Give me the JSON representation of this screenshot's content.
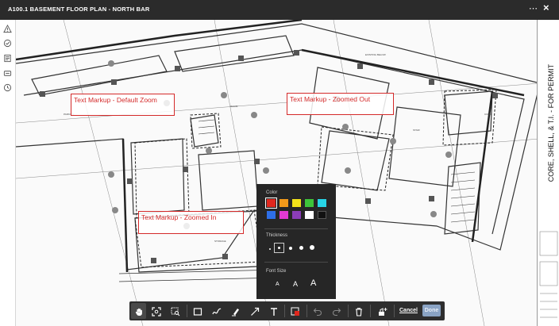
{
  "window": {
    "title": "A100.1 BASEMENT FLOOR PLAN - NORTH BAR",
    "more_icon": "more-icon",
    "close_icon": "close-icon"
  },
  "left_toolbar": [
    "warning-icon",
    "check-circle-icon",
    "sheet-icon",
    "tag-icon",
    "clock-icon"
  ],
  "markups": [
    {
      "text": "Text Markup - Default Zoom"
    },
    {
      "text": "Text Markup - Zoomed Out"
    },
    {
      "text": "Text Markup - Zoomed In"
    }
  ],
  "title_block": {
    "vertical_text": "CORE, SHELL, & T.I. - FOR PERMIT"
  },
  "style_panel": {
    "color_label": "Color",
    "colors": [
      "#e0281e",
      "#f39a1a",
      "#f3e31a",
      "#3ec43a",
      "#27d4e6",
      "#2e6fe8",
      "#e23ad3",
      "#8a3db8",
      "#ffffff",
      "#111111"
    ],
    "selected_color": "#e0281e",
    "thickness_label": "Thickness",
    "thickness_levels": 5,
    "selected_thickness": 2,
    "font_size_label": "Font Size",
    "font_sizes": [
      "A",
      "A",
      "A"
    ]
  },
  "bottom_toolbar": {
    "tools": [
      "pan-icon",
      "zoom-fit-icon",
      "zoom-area-icon",
      "rectangle-icon",
      "freehand-icon",
      "highlighter-icon",
      "arrow-icon",
      "text-icon",
      "color-style-icon",
      "undo-icon",
      "redo-icon",
      "trash-icon",
      "stamp-icon"
    ],
    "cancel_label": "Cancel",
    "done_label": "Done"
  }
}
